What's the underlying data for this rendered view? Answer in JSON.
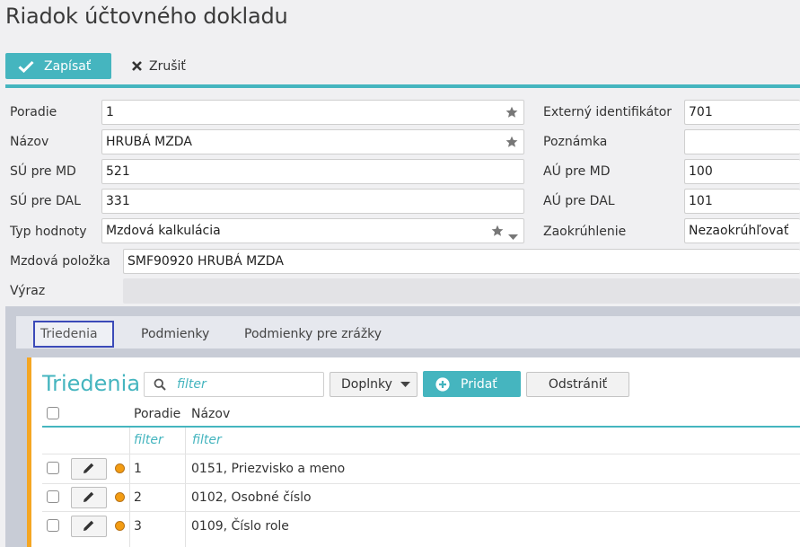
{
  "page": {
    "title": "Riadok účtovného dokladu"
  },
  "toolbar": {
    "save_label": "Zapísať",
    "cancel_label": "Zrušiť"
  },
  "form": {
    "poradie": {
      "label": "Poradie",
      "value": "1"
    },
    "nazov": {
      "label": "Názov",
      "value": "HRUBÁ MZDA"
    },
    "su_md": {
      "label": "SÚ pre MD",
      "value": "521"
    },
    "su_dal": {
      "label": "SÚ pre DAL",
      "value": "331"
    },
    "typ_hodnoty": {
      "label": "Typ hodnoty",
      "value": "Mzdová kalkulácia"
    },
    "ext_id": {
      "label": "Externý identifikátor",
      "value": "701"
    },
    "poznamka": {
      "label": "Poznámka",
      "value": ""
    },
    "au_md": {
      "label": "AÚ pre MD",
      "value": "100"
    },
    "au_dal": {
      "label": "AÚ pre DAL",
      "value": "101"
    },
    "zaokruhlenie": {
      "label": "Zaokrúhlenie",
      "value": "Nezaokrúhľovať"
    },
    "mzdova_polozka": {
      "label": "Mzdová položka",
      "value": "SMF90920 HRUBÁ MZDA"
    },
    "vyraz": {
      "label": "Výraz",
      "value": ""
    }
  },
  "tabs": [
    {
      "label": "Triedenia",
      "active": true
    },
    {
      "label": "Podmienky",
      "active": false
    },
    {
      "label": "Podmienky pre zrážky",
      "active": false
    }
  ],
  "section": {
    "title": "Triedenia",
    "search_placeholder": "filter",
    "dropdown_label": "Doplnky",
    "add_label": "Pridať",
    "remove_label": "Odstrániť"
  },
  "table": {
    "columns": [
      "Poradie",
      "Názov"
    ],
    "filter_placeholders": [
      "filter",
      "filter"
    ],
    "rows": [
      {
        "poradie": "1",
        "nazov": "0151, Priezvisko a meno"
      },
      {
        "poradie": "2",
        "nazov": "0102, Osobné číslo"
      },
      {
        "poradie": "3",
        "nazov": "0109, Číslo role"
      }
    ]
  },
  "colors": {
    "accent": "#45b5bf",
    "active_marker": "#f5a623",
    "status_dot": "#f39c12",
    "tab_focus": "#3b4ab8"
  }
}
